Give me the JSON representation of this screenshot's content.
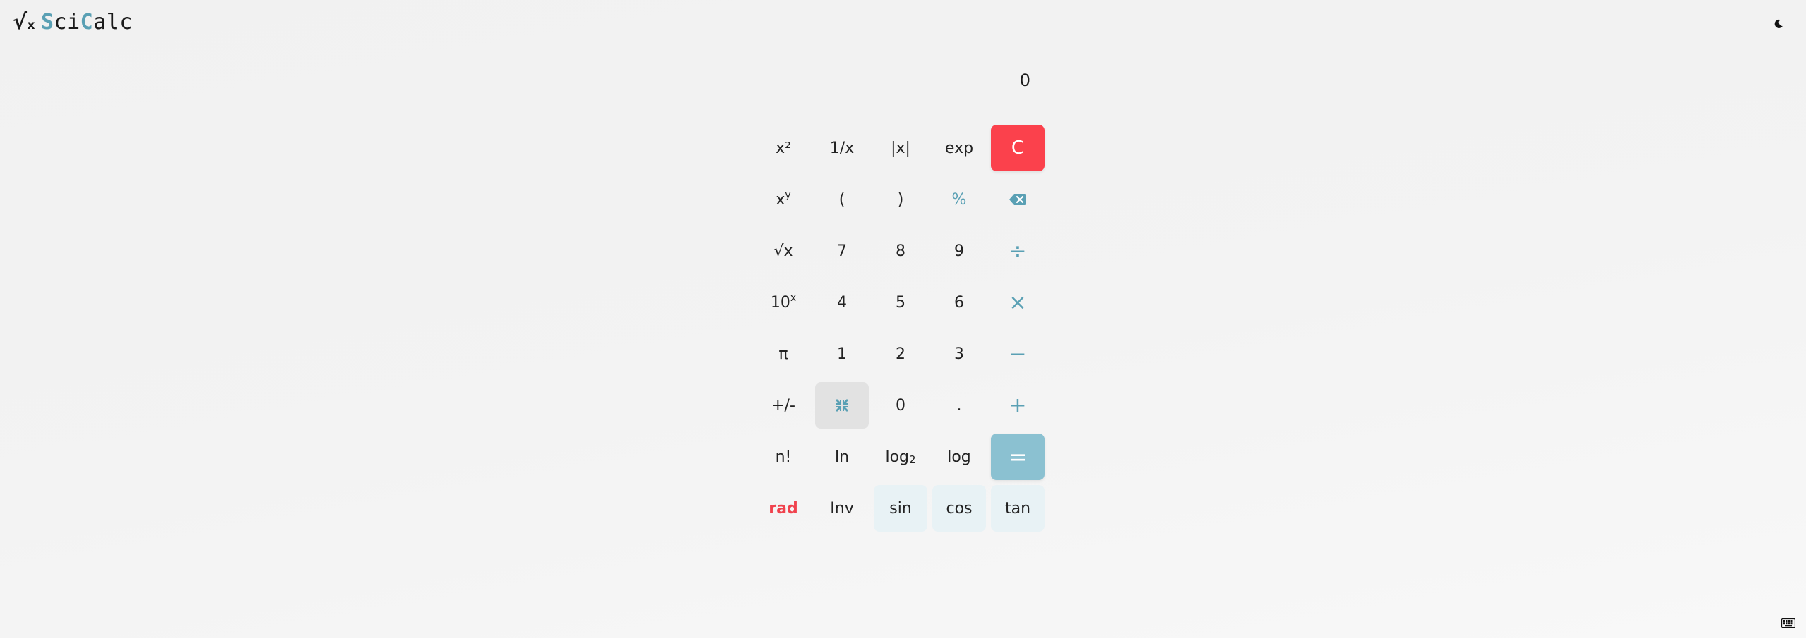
{
  "header": {
    "logo_symbol": "√",
    "logo_symbol_small": "x",
    "logo_parts": [
      "S",
      "ci",
      "C",
      "alc"
    ],
    "theme_icon": "moon-icon",
    "keyboard_icon": "keyboard-icon"
  },
  "display": {
    "value": "0"
  },
  "colors": {
    "accent": "#5aa0b4",
    "clear": "#fb414c",
    "equals": "#8bc1d1",
    "trig_bg": "#e8f2f5",
    "collapse_bg": "#e2e2e2",
    "rad": "#f0424d"
  },
  "keys": {
    "square": "x²",
    "reciprocal": "1/x",
    "abs": "|x|",
    "exp": "exp",
    "clear": "C",
    "power_base": "x",
    "power_sup": "y",
    "open_paren": "(",
    "close_paren": ")",
    "percent": "%",
    "backspace_icon": "backspace-icon",
    "sqrt": "√x",
    "seven": "7",
    "eight": "8",
    "nine": "9",
    "divide": "÷",
    "ten_pow_base": "10",
    "ten_pow_sup": "x",
    "four": "4",
    "five": "5",
    "six": "6",
    "multiply": "×",
    "pi": "π",
    "one": "1",
    "two": "2",
    "three": "3",
    "minus": "−",
    "negate": "+/-",
    "collapse_icon": "collapse-icon",
    "zero": "0",
    "decimal": ".",
    "plus": "+",
    "factorial": "n!",
    "ln": "ln",
    "log2_base": "log",
    "log2_sub": "2",
    "log": "log",
    "equals": "=",
    "rad": "rad",
    "inv": "Inv",
    "sin": "sin",
    "cos": "cos",
    "tan": "tan"
  }
}
